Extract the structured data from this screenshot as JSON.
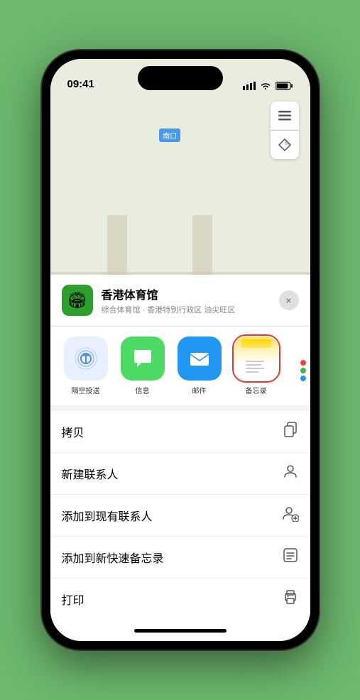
{
  "status_bar": {
    "time": "09:41",
    "signal_icon": "▌▌▌",
    "wifi_icon": "wifi",
    "battery_icon": "battery"
  },
  "map": {
    "label_nankou": "南口",
    "venue_pin_label": "香港体育馆"
  },
  "venue_sheet": {
    "name": "香港体育馆",
    "description": "综合体育馆 · 香港特别行政区 油尖旺区",
    "close_label": "×"
  },
  "share_apps": [
    {
      "id": "airdrop",
      "label": "隔空投送",
      "type": "airdrop"
    },
    {
      "id": "messages",
      "label": "信息",
      "type": "messages"
    },
    {
      "id": "mail",
      "label": "邮件",
      "type": "mail"
    },
    {
      "id": "notes",
      "label": "备忘录",
      "type": "notes",
      "selected": true
    }
  ],
  "action_items": [
    {
      "id": "copy",
      "label": "拷贝",
      "icon": "copy"
    },
    {
      "id": "new-contact",
      "label": "新建联系人",
      "icon": "person"
    },
    {
      "id": "add-existing",
      "label": "添加到现有联系人",
      "icon": "person-add"
    },
    {
      "id": "add-notes",
      "label": "添加到新快速备忘录",
      "icon": "note"
    },
    {
      "id": "print",
      "label": "打印",
      "icon": "print"
    }
  ],
  "more_dots": {
    "colors": [
      "#f44",
      "#4a4",
      "#44f"
    ]
  }
}
